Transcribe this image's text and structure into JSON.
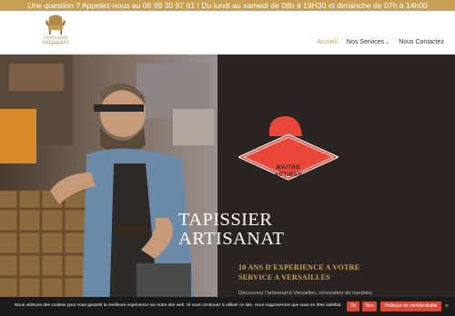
{
  "topbar": {
    "text": "Une question ? Appelez-nous au 06 99 30 97 61 ! Du lundi au samedi de 08h à 19H30 et dimanche de 07h à 14h00"
  },
  "logo": {
    "name": "TAPISSIER ARTISANAT",
    "tagline": "VERSAILLES"
  },
  "nav": {
    "items": [
      {
        "label": "Accueil",
        "active": true
      },
      {
        "label": "Nos Services",
        "dropdown": true
      },
      {
        "label": "Nous Contactez"
      }
    ]
  },
  "hero": {
    "title_line1": "TAPISSIER",
    "title_line2": "ARTISANAT",
    "subtitle_line1": "10 ANS D'EXPERIENCE A VOTRE",
    "subtitle_line2": "SERVICE A VERSAILLES",
    "description": "Découvrez l'artisanat à Versailles, rénovation de meubles"
  },
  "emblem": {
    "line1": "MAITRE",
    "line2": "ARTISAN",
    "color": "#e8473a"
  },
  "cookie": {
    "text": "Nous utilisons des cookies pour vous garantir la meilleure expérience sur notre site web. Si vous continuez à utiliser ce site, nous supposerons que vous en êtes satisfait.",
    "ok_label": "Ok",
    "no_label": "Non",
    "policy_label": "Politique de confidentialité"
  },
  "colors": {
    "accent": "#c7a055",
    "panel": "#2a2522",
    "button": "#d04b3a"
  }
}
